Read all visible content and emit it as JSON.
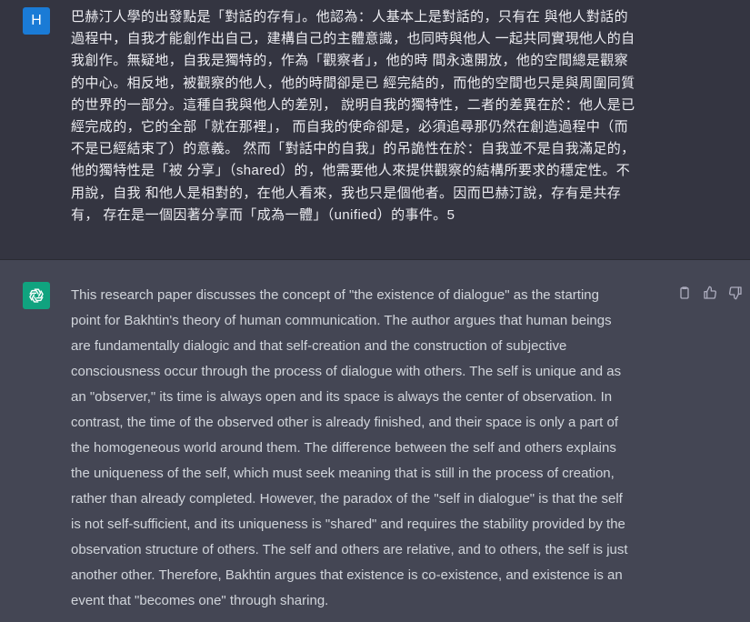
{
  "user": {
    "avatar_letter": "H",
    "avatar_color": "#1a7bd6",
    "message": "巴赫汀人學的出發點是「對話的存有」。他認為：人基本上是對話的，只有在 與他人對話的\n過程中，自我才能創作出自己，建構自己的主體意識，也同時與他人 一起共同實現他人的自\n我創作。無疑地，自我是獨特的，作為「觀察者」，他的時 間永遠開放，他的空間總是觀察\n的中心。相反地，被觀察的他人，他的時間卻是已 經完結的，而他的空間也只是與周圍同質\n的世界的一部分。這種自我與他人的差別， 說明自我的獨特性，二者的差異在於：他人是已\n經完成的，它的全部「就在那裡」， 而自我的使命卻是，必須追尋那仍然在創造過程中（而\n不是已經結束了）的意義。 然而「對話中的自我」的吊詭性在於：自我並不是自我滿足的，\n他的獨特性是「被 分享」（shared）的，他需要他人來提供觀察的結構所要求的穩定性。不\n用說，自我 和他人是相對的，在他人看來，我也只是個他者。因而巴赫汀說，存有是共存\n有， 存在是一個因著分享而「成為一體」（unified）的事件。5"
  },
  "assistant": {
    "avatar_icon": "openai-logo-icon",
    "avatar_color": "#10a37f",
    "message": "This research paper discusses the concept of \"the existence of dialogue\" as the starting\npoint for Bakhtin's theory of human communication. The author argues that human beings\nare fundamentally dialogic and that self-creation and the construction of subjective\nconsciousness occur through the process of dialogue with others. The self is unique and as\nan \"observer,\" its time is always open and its space is always the center of observation. In\ncontrast, the time of the observed other is already finished, and their space is only a part of\nthe homogeneous world around them. The difference between the self and others explains\nthe uniqueness of the self, which must seek meaning that is still in the process of creation,\nrather than already completed. However, the paradox of the \"self in dialogue\" is that the self\nis not self-sufficient, and its uniqueness is \"shared\" and requires the stability provided by the\nobservation structure of others. The self and others are relative, and to others, the self is just\nanother other. Therefore, Bakhtin argues that existence is co-existence, and existence is an\nevent that \"becomes one\" through sharing.",
    "actions": [
      "copy-icon",
      "thumbs-up-icon",
      "thumbs-down-icon"
    ]
  },
  "colors": {
    "user_bg": "#343541",
    "assistant_bg": "#444654",
    "text": "#ececf1",
    "icon": "#acacbe"
  }
}
